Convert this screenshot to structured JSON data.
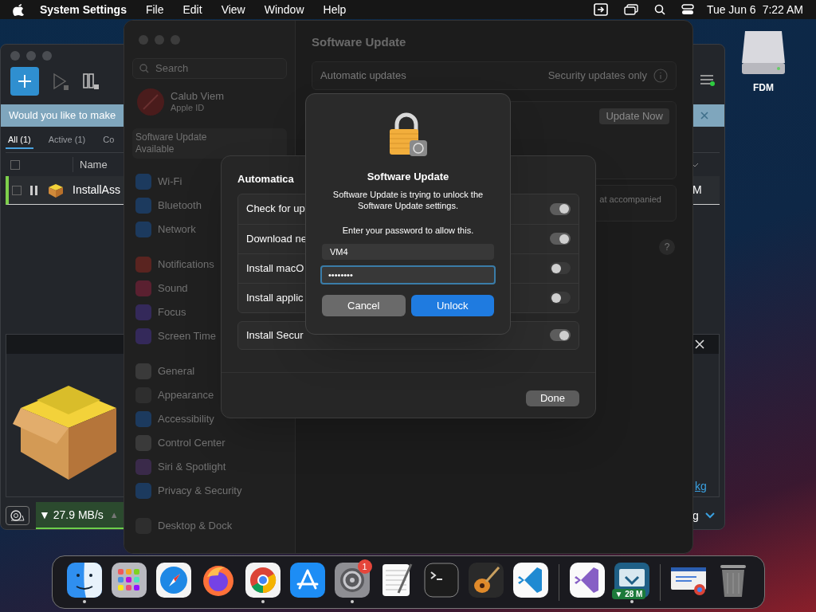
{
  "menu_bar": {
    "app": "System Settings",
    "menus": [
      "File",
      "Edit",
      "View",
      "Window",
      "Help"
    ],
    "date": "Tue Jun 6",
    "time": "7:22 AM"
  },
  "desktop": {
    "drive_label": "FDM"
  },
  "download_manager": {
    "banner": "Would you like to make",
    "tabs": [
      {
        "label": "All (1)",
        "selected": true
      },
      {
        "label": "Active (1)",
        "selected": false
      },
      {
        "label": "Co",
        "selected": false
      }
    ],
    "select_all_checked": false,
    "column": "Name",
    "row": {
      "name": "InstallAss",
      "size": "M",
      "selected": true,
      "checked": false
    },
    "link": "kg",
    "download_speed": "▼ 27.9 MB/s",
    "upload_arrow": "▲",
    "status_right": "g"
  },
  "settings": {
    "search_placeholder": "Search",
    "account": {
      "name": "Calub Viem",
      "subtitle": "Apple ID"
    },
    "update_notice": "Software Update Available",
    "groups": [
      {
        "items": [
          {
            "label": "Wi-Fi",
            "color": "#1c3a5e"
          },
          {
            "label": "Bluetooth",
            "color": "#1c3a5e"
          },
          {
            "label": "Network",
            "color": "#1c3a5e"
          }
        ]
      },
      {
        "items": [
          {
            "label": "Notifications",
            "color": "#5a2420"
          },
          {
            "label": "Sound",
            "color": "#5a2030"
          },
          {
            "label": "Focus",
            "color": "#34295a"
          },
          {
            "label": "Screen Time",
            "color": "#34295a"
          }
        ]
      },
      {
        "items": [
          {
            "label": "General",
            "color": "#3a3a3a"
          },
          {
            "label": "Appearance",
            "color": "#2e2e2e"
          },
          {
            "label": "Accessibility",
            "color": "#1c3a5e"
          },
          {
            "label": "Control Center",
            "color": "#3a3a3a"
          },
          {
            "label": "Siri & Spotlight",
            "color": "#3a2a4a"
          },
          {
            "label": "Privacy & Security",
            "color": "#1c3a5e"
          }
        ]
      },
      {
        "items": [
          {
            "label": "Desktop & Dock",
            "color": "#2e2e2e"
          }
        ]
      }
    ],
    "title": "Software Update",
    "automatic_label": "Automatic updates",
    "automatic_value": "Security updates only",
    "update_button": "Update Now",
    "note": "at accompanied",
    "help": "?"
  },
  "sheet": {
    "title": "Automatica",
    "rows": [
      {
        "label": "Check for up",
        "on": true
      },
      {
        "label": "Download ne",
        "on": true
      },
      {
        "label": "Install macO",
        "on": false
      },
      {
        "label": "Install applic",
        "on": false
      }
    ],
    "security_row": {
      "label": "Install Secur",
      "on": true
    },
    "done": "Done"
  },
  "dialog": {
    "title": "Software Update",
    "message": "Software Update is trying to unlock the Software Update settings.",
    "prompt": "Enter your password to allow this.",
    "username": "VM4",
    "password": "••••••••",
    "cancel": "Cancel",
    "unlock": "Unlock"
  },
  "dock": [
    {
      "kind": "finder",
      "running": true
    },
    {
      "kind": "launchpad",
      "running": false
    },
    {
      "kind": "safari",
      "running": false
    },
    {
      "kind": "firefox",
      "running": false
    },
    {
      "kind": "chrome",
      "running": true
    },
    {
      "kind": "appstore",
      "running": false
    },
    {
      "kind": "settings",
      "running": true,
      "badge": "1"
    },
    {
      "kind": "textedit",
      "running": false
    },
    {
      "kind": "terminal",
      "running": false
    },
    {
      "kind": "garageband",
      "running": false
    },
    {
      "kind": "vscode",
      "running": false
    },
    {
      "kind": "divider"
    },
    {
      "kind": "visualstudio",
      "running": false
    },
    {
      "kind": "fdm",
      "running": true,
      "label": "▼ 28 M"
    },
    {
      "kind": "divider"
    },
    {
      "kind": "preview",
      "running": false
    },
    {
      "kind": "trash",
      "running": false
    }
  ]
}
